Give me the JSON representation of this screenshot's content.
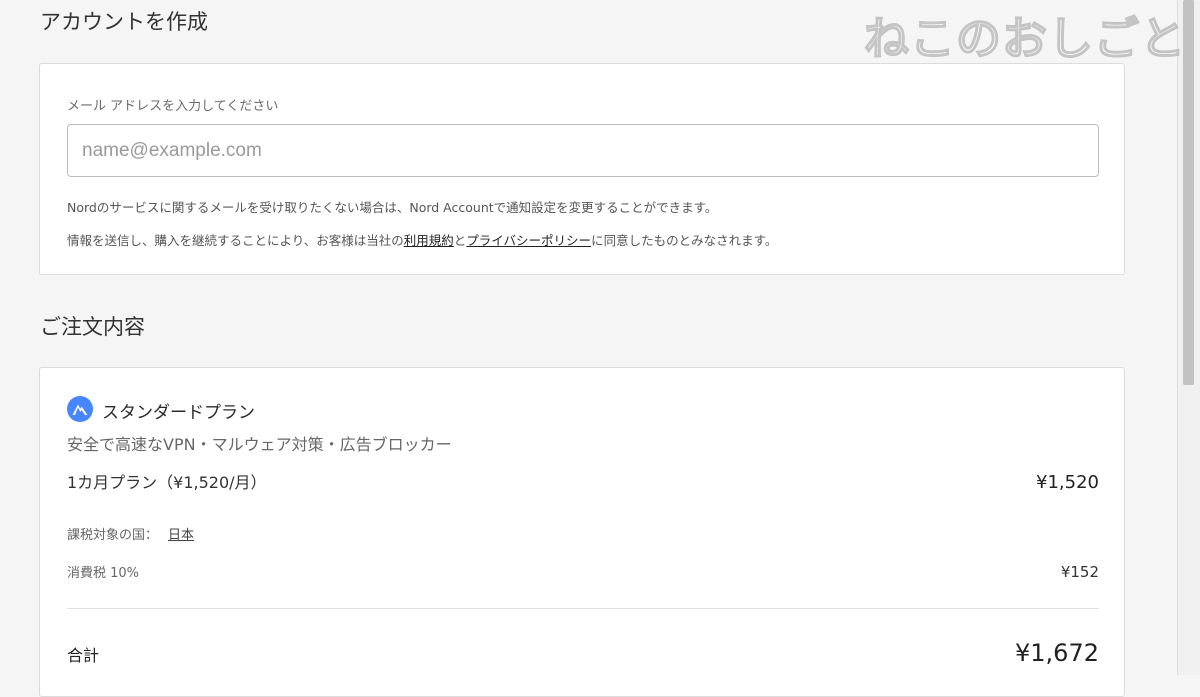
{
  "account": {
    "title": "アカウントを作成",
    "email_label": "メール アドレスを入力してください",
    "email_placeholder": "name@example.com",
    "email_value": "",
    "note1": "Nordのサービスに関するメールを受け取りたくない場合は、Nord Accountで通知設定を変更することができます。",
    "note2_before": "情報を送信し、購入を継続することにより、お客様は当社の",
    "terms_link": "利用規約",
    "note2_and": "と",
    "privacy_link": "プライバシーポリシー",
    "note2_after": "に同意したものとみなされます。"
  },
  "order": {
    "title": "ご注文内容",
    "plan_name": "スタンダードプラン",
    "plan_desc": "安全で高速なVPN・マルウェア対策・広告ブロッカー",
    "plan_period_label": "1カ月プラン（¥1,520/月）",
    "plan_price": "¥1,520",
    "tax_country_label": "課税対象の国：",
    "tax_country": "日本",
    "tax_label": "消費税 10%",
    "tax_amount": "¥152",
    "total_label": "合計",
    "total_amount": "¥1,672"
  },
  "watermark": "ねこのおしごと",
  "colors": {
    "logo_blue": "#4687ff",
    "background": "#f5f5f5",
    "card": "#ffffff"
  },
  "icons": {
    "plan_logo": "nordvpn-logo-icon"
  }
}
